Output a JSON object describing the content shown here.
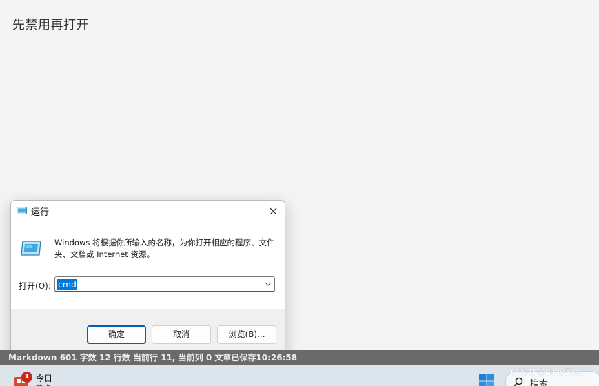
{
  "page": {
    "heading": "先禁用再打开"
  },
  "run_dialog": {
    "title": "运行",
    "description": "Windows 将根据你所输入的名称，为你打开相应的程序、文件夹、文档或 Internet 资源。",
    "open_label_prefix": "打开(",
    "open_label_key": "O",
    "open_label_suffix": "):",
    "input_value": "cmd",
    "buttons": {
      "ok": "确定",
      "cancel": "取消",
      "browse": "浏览(B)..."
    }
  },
  "status_bar": {
    "text": "Markdown  601 字数  12 行数  当前行 11, 当前列 0  文章已保存10:26:58"
  },
  "taskbar": {
    "weather_label": "今日",
    "weather_sub": "热点",
    "notification_count": "1",
    "search_label": "搜索"
  },
  "watermark": {
    "text": "CSDN @LinlyZhai"
  },
  "colors": {
    "accent": "#0067c0",
    "selection": "#0078d7",
    "status_bar": "#6a6a6a",
    "taskbar": "#dde5ec"
  }
}
